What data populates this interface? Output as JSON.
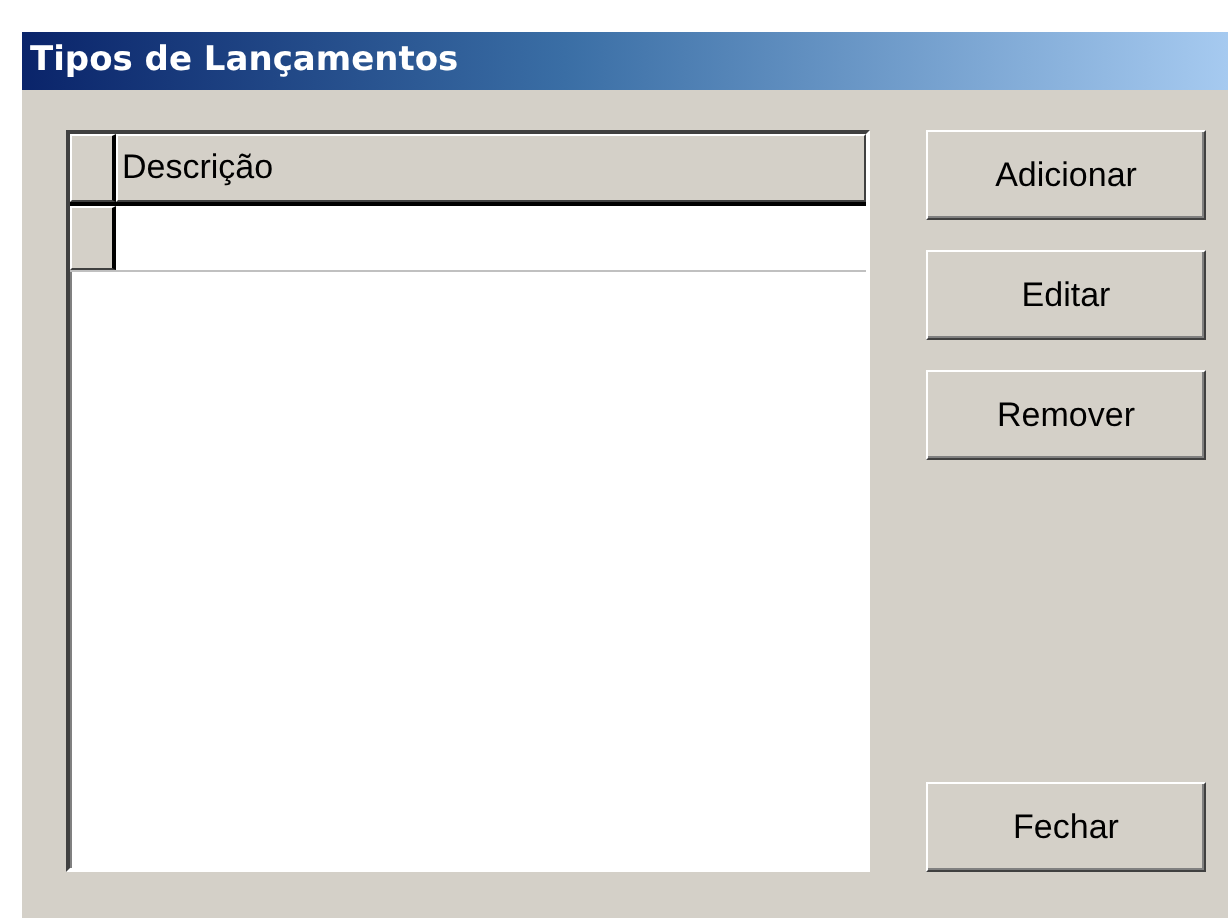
{
  "window": {
    "title": "Tipos de Lançamentos"
  },
  "grid": {
    "columns": [
      "Descrição"
    ]
  },
  "buttons": [
    {
      "label": "Adicionar",
      "kind": "action"
    },
    {
      "label": "Editar",
      "kind": "action"
    },
    {
      "label": "Remover",
      "kind": "action"
    },
    {
      "label": "Fechar",
      "kind": "close"
    }
  ]
}
